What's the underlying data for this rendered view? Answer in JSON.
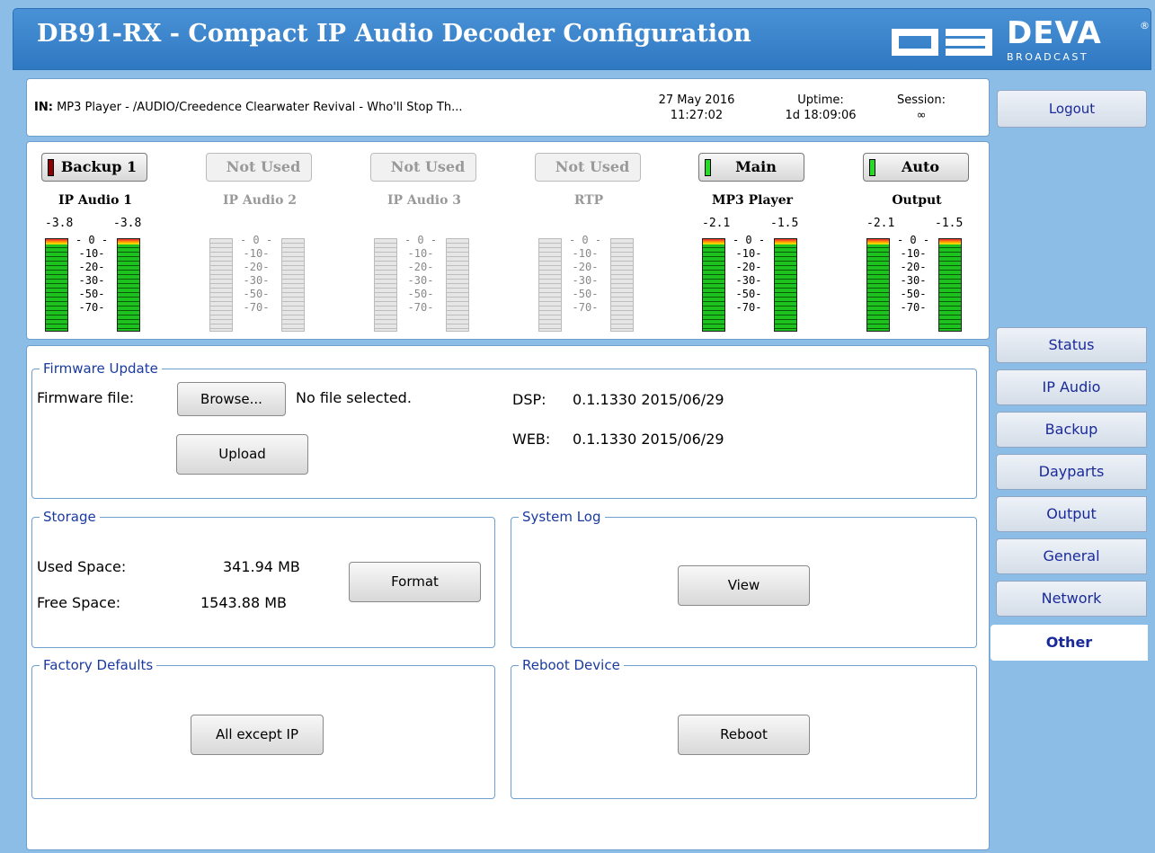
{
  "header": {
    "title": "DB91-RX - Compact IP Audio Decoder Configuration",
    "logo_brand": "DEVA",
    "logo_sub": "BROADCAST",
    "logo_reg": "®"
  },
  "infobar": {
    "in_label": "IN:",
    "in_value": "MP3 Player - /AUDIO/Creedence Clearwater Revival - Who'll Stop Th...",
    "date": "27 May 2016",
    "time": "11:27:02",
    "uptime_label": "Uptime:",
    "uptime_value": "1d 18:09:06",
    "session_label": "Session:",
    "session_value": "∞"
  },
  "logout_label": "Logout",
  "channels": [
    {
      "button": "Backup 1",
      "name": "IP Audio 1",
      "left_level": "-3.8",
      "right_level": "-3.8",
      "led": "#8b0000",
      "active": true
    },
    {
      "button": "Not Used",
      "name": "IP Audio 2",
      "left_level": "",
      "right_level": "",
      "led": "",
      "active": false
    },
    {
      "button": "Not Used",
      "name": "IP Audio 3",
      "left_level": "",
      "right_level": "",
      "led": "",
      "active": false
    },
    {
      "button": "Not Used",
      "name": "RTP",
      "left_level": "",
      "right_level": "",
      "led": "",
      "active": false
    },
    {
      "button": "Main",
      "name": "MP3 Player",
      "left_level": "-2.1",
      "right_level": "-1.5",
      "led": "#22dd22",
      "active": true
    },
    {
      "button": "Auto",
      "name": "Output",
      "left_level": "-2.1",
      "right_level": "-1.5",
      "led": "#22dd22",
      "active": true
    }
  ],
  "scale_ticks": [
    "- 0 -",
    "-10-",
    "-20-",
    "-30-",
    "-50-",
    "-70-"
  ],
  "firmware": {
    "legend": "Firmware Update",
    "file_label": "Firmware file:",
    "browse_label": "Browse...",
    "no_file": "No file selected.",
    "upload_label": "Upload",
    "dsp_label": "DSP:",
    "dsp_value": "0.1.1330 2015/06/29",
    "web_label": "WEB:",
    "web_value": "0.1.1330 2015/06/29"
  },
  "storage": {
    "legend": "Storage",
    "used_label": "Used Space:",
    "used_value": "341.94 MB",
    "free_label": "Free Space:",
    "free_value": "1543.88 MB",
    "format_label": "Format"
  },
  "syslog": {
    "legend": "System Log",
    "view_label": "View"
  },
  "factory": {
    "legend": "Factory Defaults",
    "button_label": "All except IP"
  },
  "reboot": {
    "legend": "Reboot Device",
    "button_label": "Reboot"
  },
  "nav": [
    {
      "label": "Status"
    },
    {
      "label": "IP Audio"
    },
    {
      "label": "Backup"
    },
    {
      "label": "Dayparts"
    },
    {
      "label": "Output"
    },
    {
      "label": "General"
    },
    {
      "label": "Network"
    },
    {
      "label": "Other"
    }
  ],
  "colors": {
    "header": "#3a86d0",
    "background": "#8cbde6",
    "legend": "#1a3aa0"
  }
}
